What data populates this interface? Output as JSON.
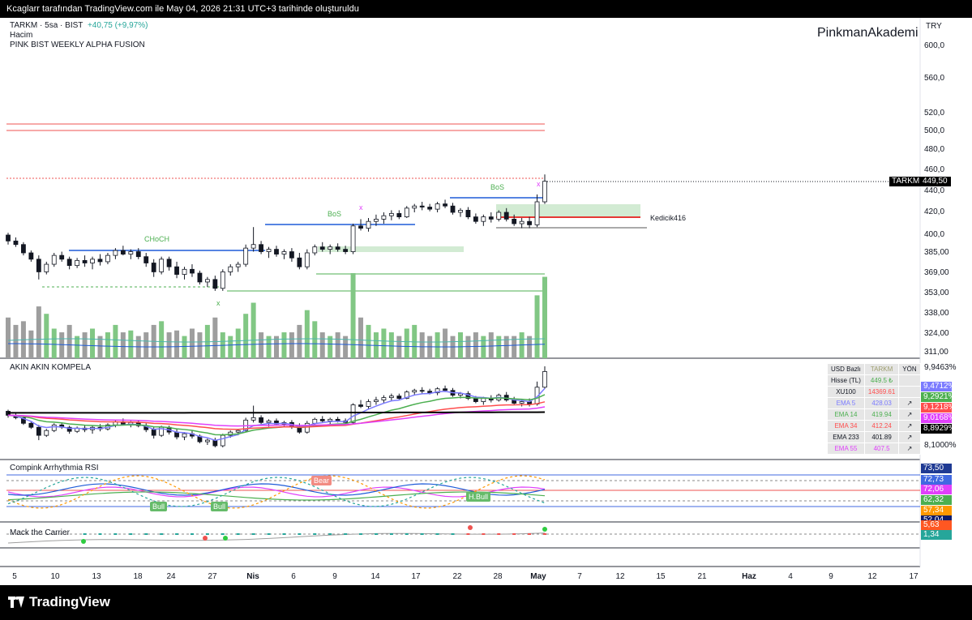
{
  "header": {
    "credit": "Kcaglarr tarafından TradingView.com ile May 04, 2026 21:31 UTC+3 tarihinde oluşturuldu"
  },
  "legend": {
    "symbol": "TARKM · 5sa · BIST",
    "change": "+40,75 (+9,97%)",
    "volume_label": "Hacim",
    "indicator": "PINK BIST WEEKLY ALPHA FUSION"
  },
  "watermark": "PinkmanAkademi",
  "currency": "TRY",
  "price_axis": [
    "600,0",
    "560,0",
    "520,0",
    "500,0",
    "480,0",
    "460,0",
    "440,0",
    "420,0",
    "400,0",
    "385,00",
    "369,00",
    "353,00",
    "338,00",
    "324,00",
    "311,00"
  ],
  "last_price": {
    "symbol": "TARKM",
    "value": "449,50"
  },
  "labels": {
    "choch": "CHoCH",
    "bos1": "BoS",
    "bos2": "BoS",
    "kedicik": "Kedicik416",
    "x1": "x",
    "x2": "x",
    "x3": "x"
  },
  "pane2": {
    "title": "AKIN AKIN KOMPELA",
    "axis_top": "9,9463%",
    "axis_bottom": "8,1000%",
    "tags": [
      {
        "value": "9,4712%",
        "color": "#7b7bff"
      },
      {
        "value": "9,2921%",
        "color": "#4caf50"
      },
      {
        "value": "9,1218%",
        "color": "#ff4d4d"
      },
      {
        "value": "9,0168%",
        "color": "#e040fb"
      },
      {
        "value": "8,8929%",
        "color": "#000000"
      }
    ],
    "table": {
      "header": [
        "USD Bazlı",
        "TARKM",
        "YÖN"
      ],
      "rows": [
        {
          "name": "Hisse (TL)",
          "value": "449.5 ₺",
          "dir": "",
          "name_color": "#131722",
          "value_color": "#4caf50"
        },
        {
          "name": "XU100",
          "value": "14369.61",
          "dir": "",
          "name_color": "#131722",
          "value_color": "#ff4d4d"
        },
        {
          "name": "EMA 5",
          "value": "428.03",
          "dir": "↗",
          "name_color": "#7b7bff",
          "value_color": "#7b7bff"
        },
        {
          "name": "EMA 14",
          "value": "419.94",
          "dir": "↗",
          "name_color": "#4caf50",
          "value_color": "#4caf50"
        },
        {
          "name": "EMA 34",
          "value": "412.24",
          "dir": "↗",
          "name_color": "#ff4d4d",
          "value_color": "#ff4d4d"
        },
        {
          "name": "EMA 233",
          "value": "401.89",
          "dir": "↗",
          "name_color": "#131722",
          "value_color": "#131722"
        },
        {
          "name": "EMA 55",
          "value": "407.5",
          "dir": "↗",
          "name_color": "#e040fb",
          "value_color": "#e040fb"
        }
      ]
    }
  },
  "pane3": {
    "title": "Compink Arrhythmia RSI",
    "tags": [
      {
        "value": "73,50",
        "color": "#1f3a93"
      },
      {
        "value": "72,73",
        "color": "#4169e1"
      },
      {
        "value": "72,06",
        "color": "#e040fb"
      },
      {
        "value": "62,32",
        "color": "#4caf50"
      },
      {
        "value": "57,34",
        "color": "#ff9800"
      },
      {
        "value": "52,04",
        "color": "#0d1b6b"
      }
    ],
    "labels": {
      "bear": "Bear",
      "bull1": "Bull",
      "bull2": "Bull",
      "hbull": "H.Bull"
    }
  },
  "pane4": {
    "title": "Mack the Carrier",
    "tags": [
      {
        "value": "5,63",
        "color": "#ff5722"
      },
      {
        "value": "1,34",
        "color": "#26a69a"
      }
    ]
  },
  "time_axis": [
    {
      "label": "5",
      "bold": false
    },
    {
      "label": "10",
      "bold": false
    },
    {
      "label": "13",
      "bold": false
    },
    {
      "label": "18",
      "bold": false
    },
    {
      "label": "24",
      "bold": false
    },
    {
      "label": "27",
      "bold": false
    },
    {
      "label": "Nis",
      "bold": true
    },
    {
      "label": "6",
      "bold": false
    },
    {
      "label": "9",
      "bold": false
    },
    {
      "label": "14",
      "bold": false
    },
    {
      "label": "17",
      "bold": false
    },
    {
      "label": "22",
      "bold": false
    },
    {
      "label": "28",
      "bold": false
    },
    {
      "label": "May",
      "bold": true
    },
    {
      "label": "7",
      "bold": false
    },
    {
      "label": "12",
      "bold": false
    },
    {
      "label": "15",
      "bold": false
    },
    {
      "label": "21",
      "bold": false
    },
    {
      "label": "Haz",
      "bold": true
    },
    {
      "label": "4",
      "bold": false
    },
    {
      "label": "9",
      "bold": false
    },
    {
      "label": "12",
      "bold": false
    },
    {
      "label": "17",
      "bold": false
    }
  ],
  "footer": {
    "brand": "TradingView"
  },
  "colors": {
    "up": "#26a69a",
    "down": "#ef5350",
    "blue_line": "#1e5bd8",
    "red_line": "#e53935"
  },
  "chart_data": {
    "type": "candlestick",
    "candles": [
      [
        400,
        402,
        392,
        395
      ],
      [
        395,
        398,
        390,
        392
      ],
      [
        392,
        394,
        383,
        385
      ],
      [
        385,
        387,
        378,
        380
      ],
      [
        380,
        383,
        364,
        370
      ],
      [
        370,
        378,
        368,
        376
      ],
      [
        376,
        385,
        374,
        383
      ],
      [
        383,
        386,
        378,
        380
      ],
      [
        380,
        382,
        372,
        375
      ],
      [
        375,
        381,
        373,
        379
      ],
      [
        379,
        383,
        374,
        377
      ],
      [
        377,
        382,
        372,
        380
      ],
      [
        380,
        384,
        375,
        378
      ],
      [
        378,
        385,
        376,
        383
      ],
      [
        383,
        389,
        380,
        387
      ],
      [
        387,
        391,
        383,
        384
      ],
      [
        384,
        388,
        380,
        386
      ],
      [
        386,
        389,
        380,
        382
      ],
      [
        382,
        385,
        374,
        377
      ],
      [
        377,
        380,
        366,
        370
      ],
      [
        370,
        382,
        368,
        380
      ],
      [
        380,
        382,
        371,
        374
      ],
      [
        374,
        378,
        365,
        368
      ],
      [
        368,
        374,
        364,
        372
      ],
      [
        372,
        376,
        366,
        369
      ],
      [
        369,
        371,
        360,
        362
      ],
      [
        362,
        366,
        358,
        364
      ],
      [
        364,
        367,
        355,
        357
      ],
      [
        357,
        372,
        355,
        370
      ],
      [
        370,
        376,
        367,
        374
      ],
      [
        374,
        378,
        370,
        376
      ],
      [
        376,
        392,
        374,
        389
      ],
      [
        389,
        407,
        386,
        392
      ],
      [
        392,
        395,
        384,
        386
      ],
      [
        386,
        390,
        381,
        388
      ],
      [
        388,
        391,
        382,
        384
      ],
      [
        384,
        388,
        380,
        386
      ],
      [
        386,
        389,
        378,
        381
      ],
      [
        381,
        385,
        372,
        374
      ],
      [
        374,
        388,
        372,
        385
      ],
      [
        385,
        392,
        383,
        390
      ],
      [
        390,
        394,
        386,
        388
      ],
      [
        388,
        392,
        384,
        390
      ],
      [
        390,
        393,
        386,
        388
      ],
      [
        388,
        391,
        384,
        386
      ],
      [
        386,
        410,
        384,
        408
      ],
      [
        408,
        414,
        404,
        406
      ],
      [
        406,
        415,
        403,
        412
      ],
      [
        412,
        418,
        408,
        414
      ],
      [
        414,
        420,
        410,
        417
      ],
      [
        417,
        422,
        413,
        419
      ],
      [
        419,
        422,
        414,
        416
      ],
      [
        416,
        426,
        415,
        424
      ],
      [
        424,
        428,
        420,
        426
      ],
      [
        426,
        430,
        422,
        425
      ],
      [
        425,
        428,
        421,
        423
      ],
      [
        423,
        430,
        420,
        428
      ],
      [
        428,
        432,
        424,
        426
      ],
      [
        426,
        429,
        418,
        420
      ],
      [
        420,
        424,
        416,
        422
      ],
      [
        422,
        425,
        414,
        416
      ],
      [
        416,
        419,
        410,
        412
      ],
      [
        412,
        418,
        408,
        416
      ],
      [
        416,
        420,
        411,
        414
      ],
      [
        414,
        422,
        412,
        420
      ],
      [
        420,
        424,
        412,
        414
      ],
      [
        414,
        418,
        408,
        410
      ],
      [
        410,
        415,
        406,
        412
      ],
      [
        412,
        416,
        406,
        409
      ],
      [
        409,
        437,
        407,
        430
      ],
      [
        430,
        456,
        428,
        449.5
      ]
    ],
    "volumes": [
      22,
      18,
      20,
      15,
      28,
      24,
      16,
      14,
      18,
      12,
      14,
      16,
      12,
      14,
      18,
      14,
      15,
      12,
      14,
      18,
      20,
      14,
      15,
      12,
      16,
      14,
      18,
      22,
      14,
      12,
      16,
      24,
      30,
      14,
      12,
      12,
      14,
      14,
      18,
      26,
      20,
      14,
      12,
      14,
      12,
      46,
      22,
      18,
      14,
      16,
      14,
      12,
      16,
      18,
      14,
      12,
      14,
      16,
      12,
      14,
      12,
      14,
      12,
      14,
      12,
      12,
      12,
      14,
      12,
      34,
      44
    ]
  }
}
